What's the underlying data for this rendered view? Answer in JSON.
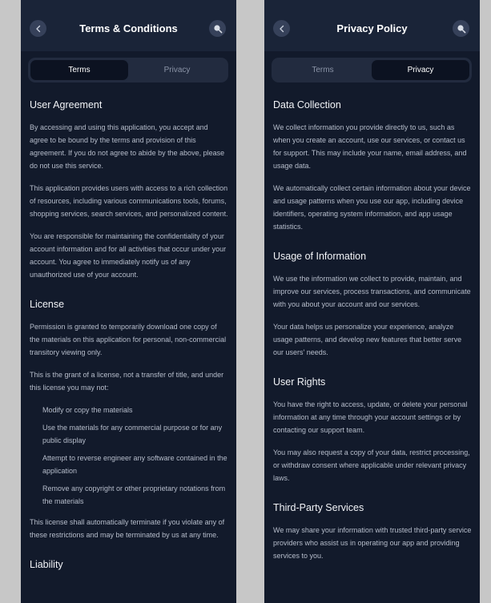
{
  "left": {
    "title": "Terms & Conditions",
    "tabs": [
      "Terms",
      "Privacy"
    ],
    "active_tab": 0,
    "sections": [
      {
        "heading": "User Agreement",
        "paragraphs": [
          "By accessing and using this application, you accept and agree to be bound by the terms and provision of this agreement. If you do not agree to abide by the above, please do not use this service.",
          "This application provides users with access to a rich collection of resources, including various communications tools, forums, shopping services, search services, and personalized content.",
          "You are responsible for maintaining the confidentiality of your account information and for all activities that occur under your account. You agree to immediately notify us of any unauthorized use of your account."
        ]
      },
      {
        "heading": "License",
        "paragraphs": [
          "Permission is granted to temporarily download one copy of the materials on this application for personal, non-commercial transitory viewing only.",
          "This is the grant of a license, not a transfer of title, and under this license you may not:"
        ],
        "list": [
          "Modify or copy the materials",
          "Use the materials for any commercial purpose or for any public display",
          "Attempt to reverse engineer any software contained in the application",
          "Remove any copyright or other proprietary notations from the materials"
        ],
        "after": "This license shall automatically terminate if you violate any of these restrictions and may be terminated by us at any time."
      },
      {
        "heading": "Liability"
      }
    ]
  },
  "right": {
    "title": "Privacy Policy",
    "tabs": [
      "Terms",
      "Privacy"
    ],
    "active_tab": 1,
    "sections": [
      {
        "heading": "Data Collection",
        "paragraphs": [
          "We collect information you provide directly to us, such as when you create an account, use our services, or contact us for support. This may include your name, email address, and usage data.",
          "We automatically collect certain information about your device and usage patterns when you use our app, including device identifiers, operating system information, and app usage statistics."
        ]
      },
      {
        "heading": "Usage of Information",
        "paragraphs": [
          "We use the information we collect to provide, maintain, and improve our services, process transactions, and communicate with you about your account and our services.",
          "Your data helps us personalize your experience, analyze usage patterns, and develop new features that better serve our users' needs."
        ]
      },
      {
        "heading": "User Rights",
        "paragraphs": [
          "You have the right to access, update, or delete your personal information at any time through your account settings or by contacting our support team.",
          "You may also request a copy of your data, restrict processing, or withdraw consent where applicable under relevant privacy laws."
        ]
      },
      {
        "heading": "Third-Party Services",
        "paragraphs": [
          "We may share your information with trusted third-party service providers who assist us in operating our app and providing services to you."
        ]
      }
    ]
  },
  "colors": {
    "background": "#121a2b",
    "header": "#1a2438",
    "accent_text": "#ffffff",
    "body_text": "#b6bdcb"
  },
  "icons": {
    "back": "chevron-left-icon",
    "search": "search-icon"
  }
}
